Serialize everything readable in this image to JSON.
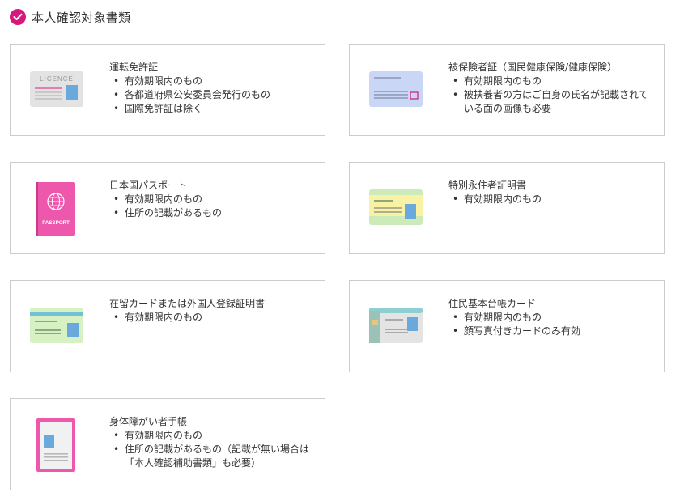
{
  "header": {
    "title": "本人確認対象書類"
  },
  "cards": [
    {
      "title": "運転免許証",
      "items": [
        "有効期限内のもの",
        "各都道府県公安委員会発行のもの",
        "国際免許証は除く"
      ],
      "icon": "driver-license-icon",
      "icon_text": "LICENCE"
    },
    {
      "title": "被保険者証（国民健康保険/健康保険）",
      "items": [
        "有効期限内のもの",
        "被扶養者の方はご自身の氏名が記載されている面の画像も必要"
      ],
      "icon": "insurance-card-icon"
    },
    {
      "title": "日本国パスポート",
      "items": [
        "有効期限内のもの",
        "住所の記載があるもの"
      ],
      "icon": "passport-icon",
      "icon_text": "PASSPORT"
    },
    {
      "title": "特別永住者証明書",
      "items": [
        "有効期限内のもの"
      ],
      "icon": "permanent-resident-card-icon"
    },
    {
      "title": "在留カードまたは外国人登録証明書",
      "items": [
        "有効期限内のもの"
      ],
      "icon": "residence-card-icon"
    },
    {
      "title": "住民基本台帳カード",
      "items": [
        "有効期限内のもの",
        "顔写真付きカードのみ有効"
      ],
      "icon": "resident-registry-card-icon"
    },
    {
      "title": "身体障がい者手帳",
      "items": [
        "有効期限内のもの",
        "住所の記載があるもの（記載が無い場合は「本人確認補助書類」も必要）"
      ],
      "icon": "disability-handbook-icon"
    }
  ],
  "colors": {
    "accent": "#d6177d",
    "border": "#cccccc",
    "text": "#333333"
  }
}
